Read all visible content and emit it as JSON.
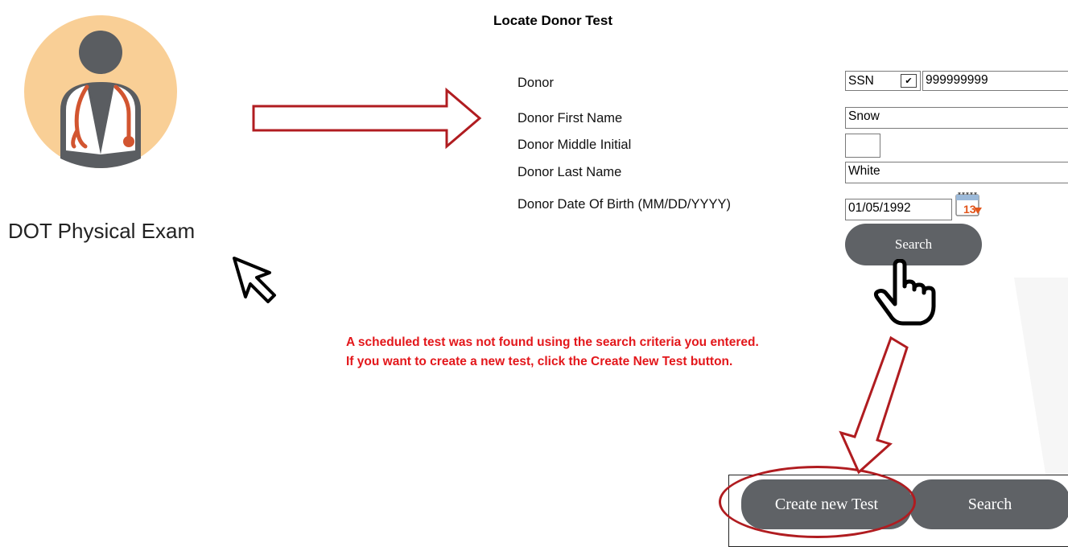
{
  "left_panel": {
    "label": "DOT Physical Exam",
    "icon": "doctor-avatar-icon",
    "colors": {
      "circle": "#f9cf96",
      "figure": "#5a5d61",
      "coat": "#ffffff",
      "stethoscope": "#d25530"
    }
  },
  "form": {
    "title": "Locate Donor Test",
    "labels": {
      "donor": "Donor",
      "first_name": "Donor First Name",
      "middle_initial": "Donor Middle Initial",
      "last_name": "Donor Last Name",
      "dob": "Donor Date Of Birth (MM/DD/YYYY)"
    },
    "donor_id_type": "SSN",
    "donor_id_value": "999999999",
    "first_name_value": "Snow",
    "middle_initial_value": "",
    "last_name_value": "White",
    "dob_value": "01/05/1992",
    "calendar_icon": "calendar-icon",
    "calendar_day": "13",
    "search_label": "Search"
  },
  "message": {
    "line1": "A scheduled test was not found using the search criteria you entered.",
    "line2": "If you want to create a new test, click the Create New Test button."
  },
  "actions": {
    "create_label": "Create new Test",
    "search_label": "Search"
  },
  "colors": {
    "button_bg": "#5f6266",
    "error_text": "#e3171b",
    "annotation_red": "#b01c20"
  }
}
